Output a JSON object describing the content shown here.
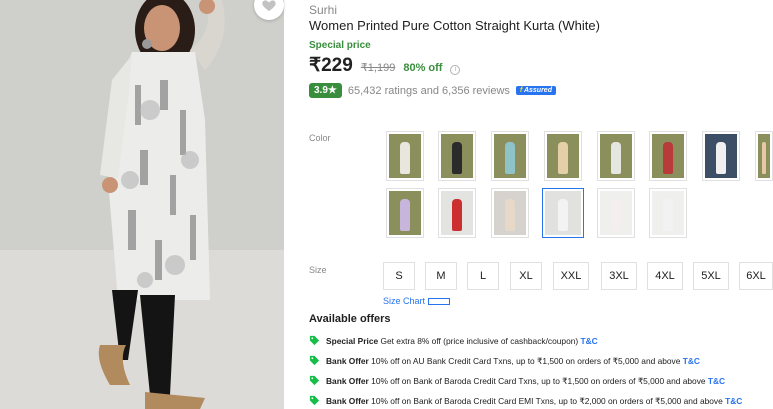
{
  "product": {
    "brand": "Surhi",
    "title": "Women Printed Pure Cotton Straight Kurta  (White)",
    "special_price_label": "Special price",
    "price": "₹229",
    "mrp": "₹1,199",
    "discount": "80% off",
    "info_icon": "i",
    "rating": "3.9★",
    "ratings_text": "65,432 ratings and 6,356 reviews",
    "assured": "Assured",
    "assured_plus": "f"
  },
  "color": {
    "label": "Color",
    "swatches": [
      {
        "name": "green-white",
        "tint": "#e9e6dd"
      },
      {
        "name": "black",
        "tint": "#2b2b2b"
      },
      {
        "name": "teal",
        "tint": "#8fc3c8"
      },
      {
        "name": "beige",
        "tint": "#e4cfa8"
      },
      {
        "name": "white-green",
        "tint": "#e6e6e0"
      },
      {
        "name": "red-maroon",
        "tint": "#b83a3a"
      },
      {
        "name": "navy-white",
        "tint": "#f0f0f0"
      },
      {
        "name": "peach",
        "tint": "#e7c7a6"
      },
      {
        "name": "lavender",
        "tint": "#c7b5dc"
      },
      {
        "name": "red",
        "tint": "#cc2f2f"
      },
      {
        "name": "off-white-print",
        "tint": "#e8d8c8"
      },
      {
        "name": "white-selected",
        "tint": "#f3f3f3"
      },
      {
        "name": "white-floral",
        "tint": "#f5eeee"
      },
      {
        "name": "white-black-print",
        "tint": "#f2f2f2"
      }
    ]
  },
  "size": {
    "label": "Size",
    "options": [
      "S",
      "M",
      "L",
      "XL",
      "XXL",
      "3XL",
      "4XL",
      "5XL",
      "6XL"
    ],
    "chart_label": "Size Chart"
  },
  "offers": {
    "heading": "Available offers",
    "items": [
      {
        "type": "Special Price",
        "text": "Get extra 8% off (price inclusive of cashback/coupon)",
        "link": "T&C"
      },
      {
        "type": "Bank Offer",
        "text": "10% off on AU Bank Credit Card Txns, up to ₹1,500 on orders of ₹5,000 and above",
        "link": "T&C"
      },
      {
        "type": "Bank Offer",
        "text": "10% off on Bank of Baroda Credit Card Txns, up to ₹1,500 on orders of ₹5,000 and above",
        "link": "T&C"
      },
      {
        "type": "Bank Offer",
        "text": "10% off on Bank of Baroda Credit Card EMI Txns, up to ₹2,000 on orders of ₹5,000 and above",
        "link": "T&C"
      }
    ]
  },
  "colors": {
    "green": "#388e3c",
    "blue": "#2874f0",
    "grey": "#878787"
  }
}
